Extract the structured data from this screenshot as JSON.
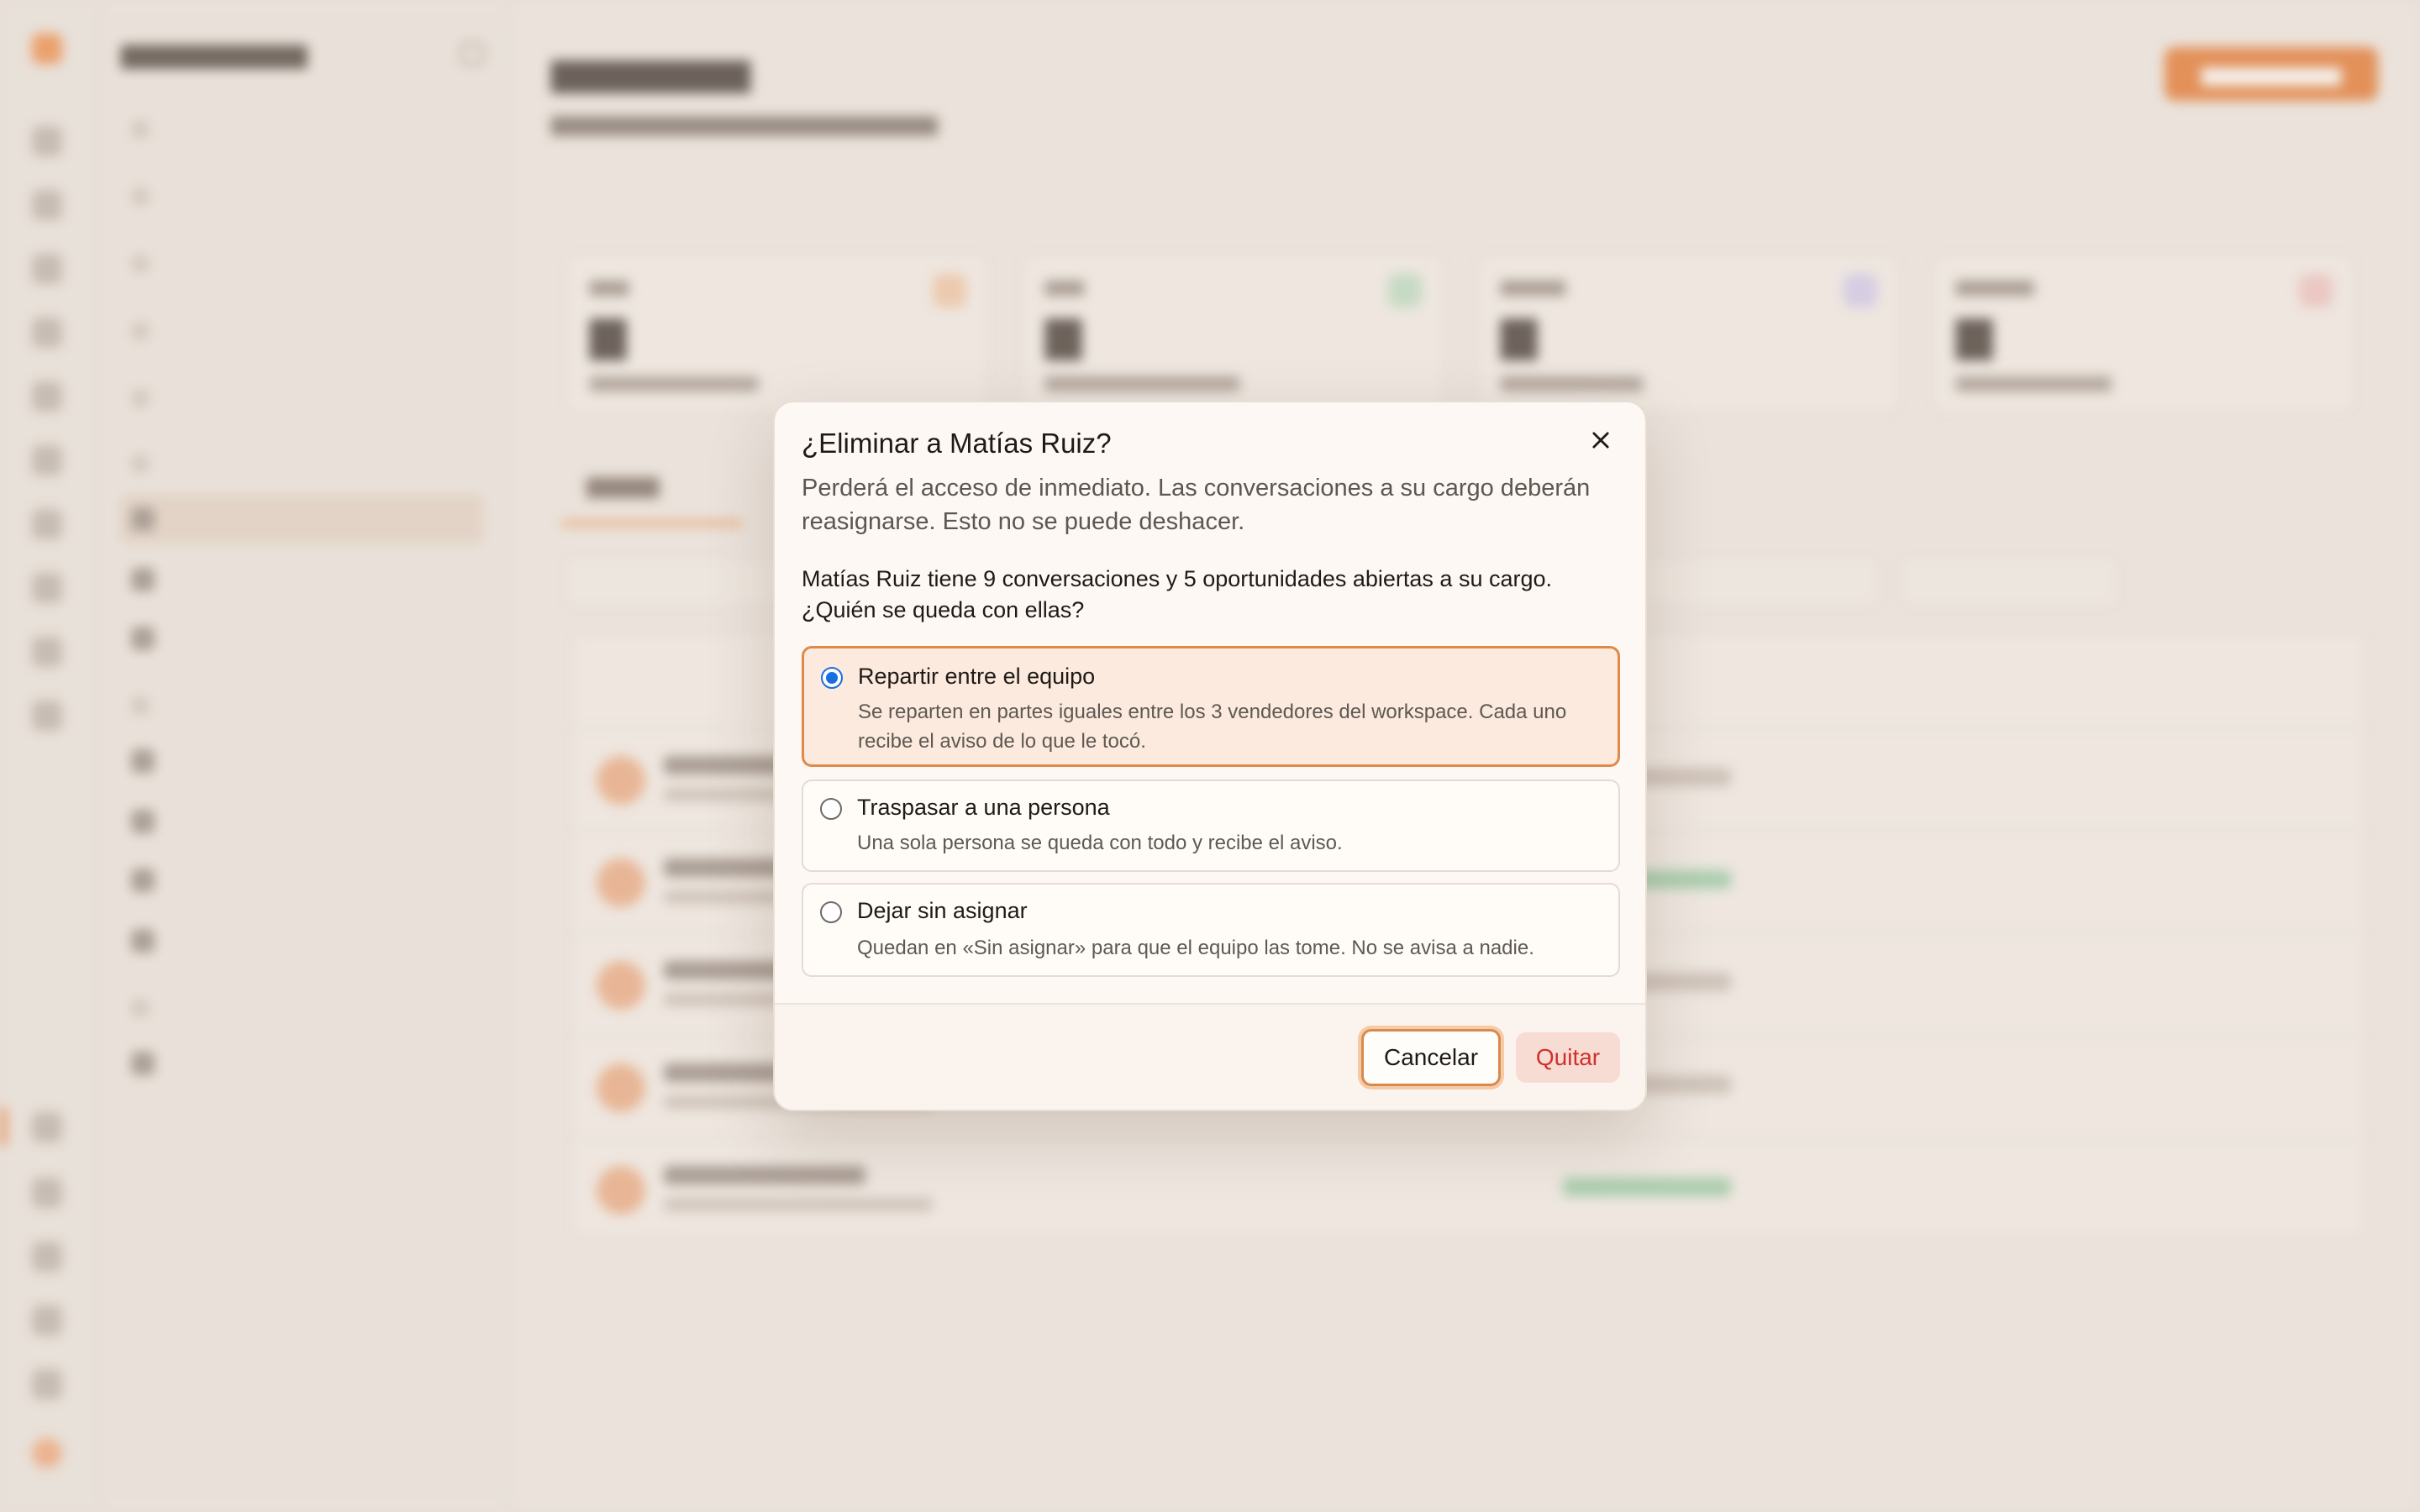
{
  "dialog": {
    "title": "¿Eliminar a Matías Ruiz?",
    "description": "Perderá el acceso de inmediato. Las conversaciones a su cargo deberán reasignarse. Esto no se puede deshacer.",
    "question_line1": "Matías Ruiz tiene 9 conversaciones y 5 oportunidades abiertas a su cargo.",
    "question_line2": "¿Quién se queda con ellas?",
    "options": [
      {
        "title": "Repartir entre el equipo",
        "description": "Se reparten en partes iguales entre los 3 vendedores del workspace. Cada uno recibe el aviso de lo que le tocó.",
        "selected": true
      },
      {
        "title": "Traspasar a una persona",
        "description": "Una sola persona se queda con todo y recibe el aviso.",
        "selected": false
      },
      {
        "title": "Dejar sin asignar",
        "description": "Quedan en «Sin asignar» para que el equipo las tome. No se avisa a nadie.",
        "selected": false
      }
    ],
    "cancel_label": "Cancelar",
    "confirm_label": "Quitar",
    "close_icon": "close-icon"
  },
  "colors": {
    "accent": "#e36b1c",
    "selected_border": "#df8a4a",
    "selected_bg": "#fbeadd",
    "radio_blue": "#1a6fe0",
    "danger_text": "#d0302c",
    "danger_bg": "#f7dcd4"
  }
}
